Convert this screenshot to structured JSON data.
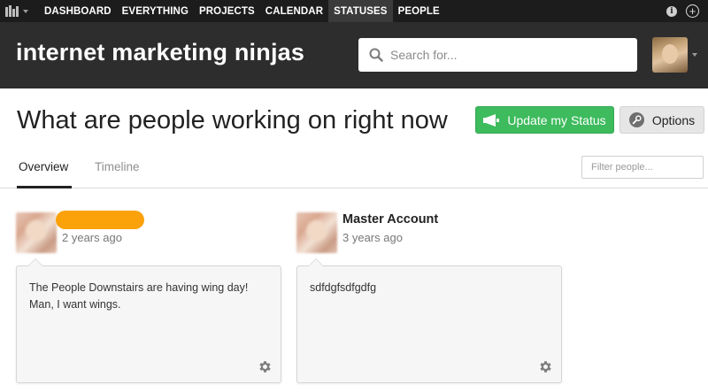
{
  "nav": {
    "items": [
      "DASHBOARD",
      "EVERYTHING",
      "PROJECTS",
      "CALENDAR",
      "STATUSES",
      "PEOPLE"
    ],
    "active": "STATUSES",
    "info_glyph": "i",
    "plus_glyph": "+"
  },
  "header": {
    "org_name": "internet marketing ninjas",
    "search_placeholder": "Search for..."
  },
  "page": {
    "title": "What are people working on right now",
    "update_button": "Update my Status",
    "options_button": "Options"
  },
  "tabs": {
    "overview": "Overview",
    "timeline": "Timeline",
    "filter_placeholder": "Filter people..."
  },
  "statuses": [
    {
      "name": "",
      "time": "2 years ago",
      "text": "The People Downstairs are having wing day! Man, I want wings."
    },
    {
      "name": "Master Account",
      "time": "3 years ago",
      "text": "sdfdgfsdfgdfg"
    }
  ],
  "colors": {
    "nav_bg": "#1c1c1c",
    "header_bg": "#2d2d2d",
    "update_green": "#3dbb5d",
    "redaction_orange": "#fba20b"
  },
  "icons": [
    "app-logo-icon",
    "menu-caret-icon",
    "info-icon",
    "add-icon",
    "search-icon",
    "megaphone-icon",
    "wrench-icon",
    "gear-icon"
  ]
}
